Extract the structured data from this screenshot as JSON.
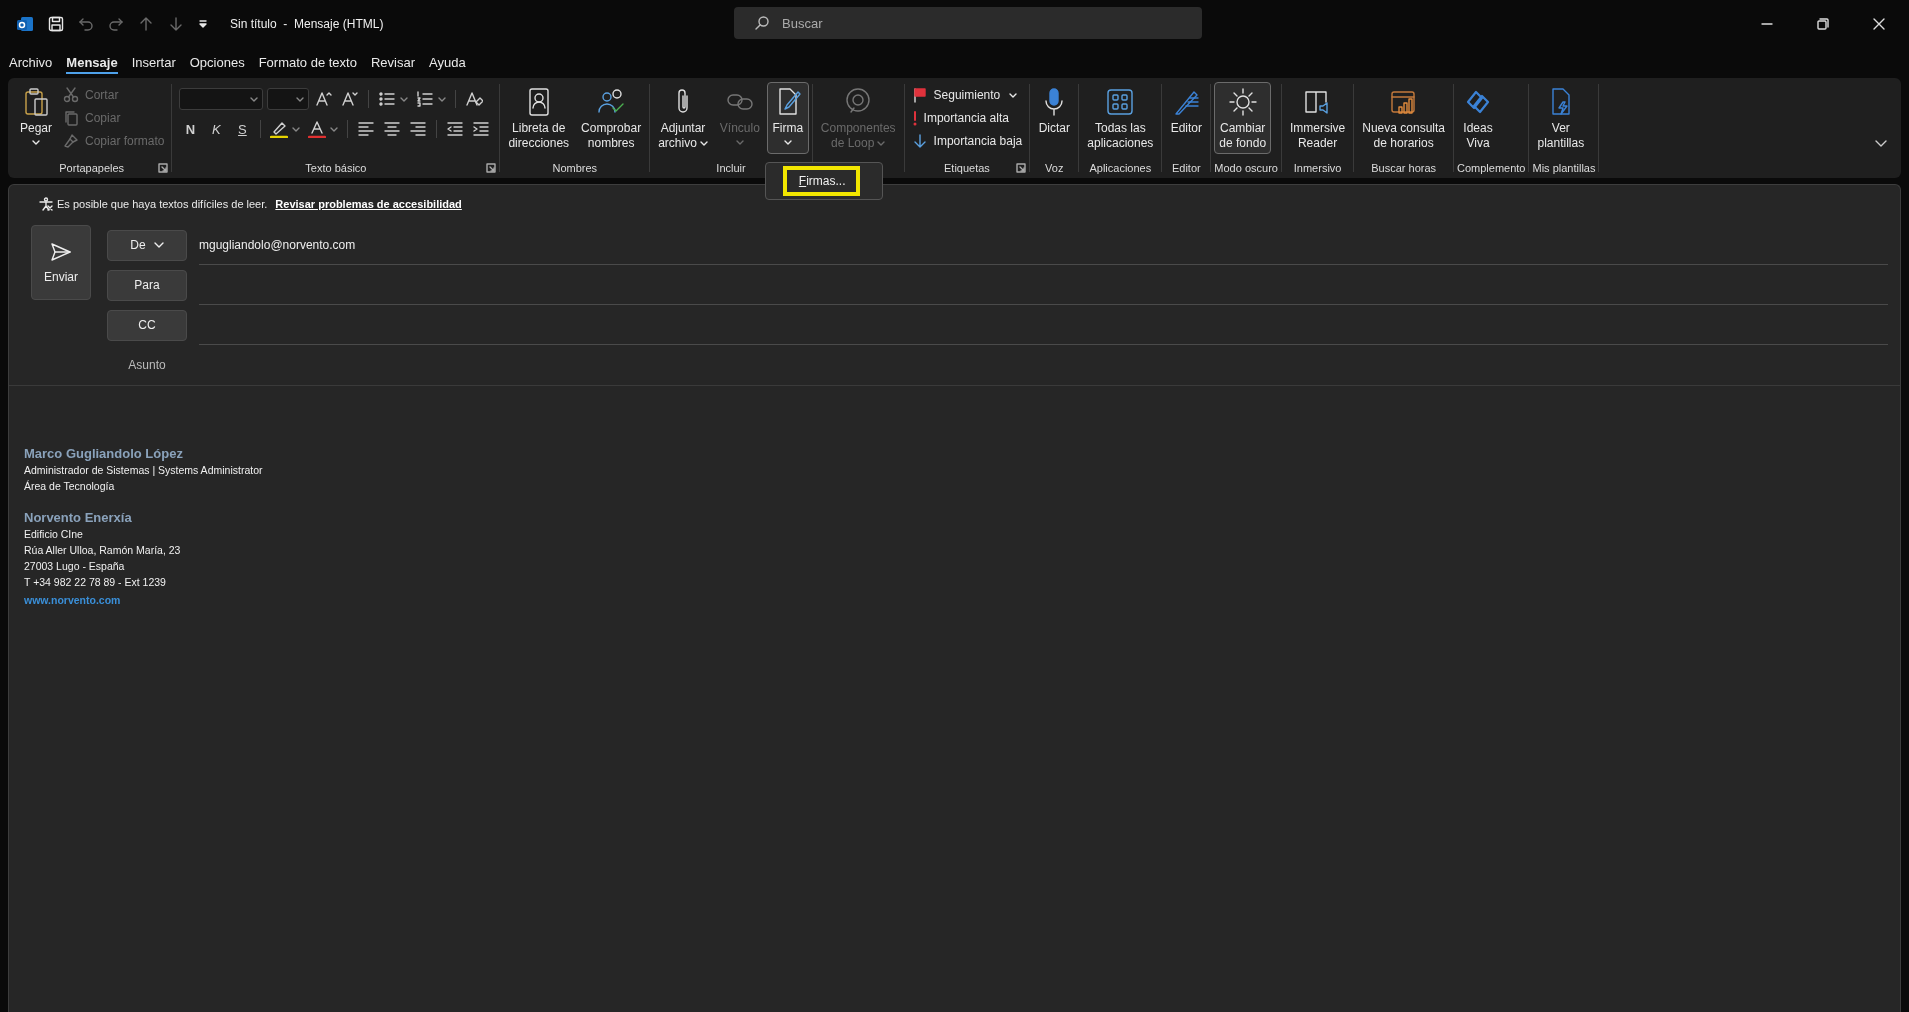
{
  "title_bar": {
    "title": "Sin título  -  Mensaje (HTML)",
    "search": {
      "placeholder": "Buscar"
    }
  },
  "menu_tabs": [
    {
      "label": "Archivo",
      "selected": false
    },
    {
      "label": "Mensaje",
      "selected": true
    },
    {
      "label": "Insertar",
      "selected": false
    },
    {
      "label": "Opciones",
      "selected": false
    },
    {
      "label": "Formato de texto",
      "selected": false
    },
    {
      "label": "Revisar",
      "selected": false
    },
    {
      "label": "Ayuda",
      "selected": false
    }
  ],
  "ribbon": {
    "groups": [
      {
        "label": "Portapapeles",
        "launcher": true,
        "items": [
          {
            "kind": "large",
            "label": [
              "Pegar"
            ],
            "dropdown": true,
            "disabled": false,
            "pressed": false
          },
          {
            "kind": "small",
            "label": "Cortar",
            "disabled": true
          },
          {
            "kind": "small",
            "label": "Copiar",
            "disabled": true
          },
          {
            "kind": "small",
            "label": "Copiar formato",
            "disabled": true
          }
        ]
      },
      {
        "label": "Texto básico",
        "launcher": true,
        "items": [
          {
            "kind": "format",
            "rows": [
              [
                {
                  "kind": "combo"
                },
                {
                  "kind": "combo"
                },
                {
                  "kind": "icon"
                },
                {
                  "kind": "icon"
                },
                {
                  "kind": "separator"
                },
                {
                  "kind": "icon",
                  "dropdown": true
                },
                {
                  "kind": "icon",
                  "dropdown": true
                },
                {
                  "kind": "separator"
                },
                {
                  "kind": "icon"
                }
              ],
              [
                {
                  "kind": "glyph",
                  "text": "N"
                },
                {
                  "kind": "glyph",
                  "text": "K"
                },
                {
                  "kind": "glyph",
                  "text": "S"
                },
                {
                  "kind": "separator"
                },
                {
                  "kind": "icon",
                  "dropdown": true
                },
                {
                  "kind": "icon",
                  "dropdown": true
                },
                {
                  "kind": "separator"
                },
                {
                  "kind": "icon"
                },
                {
                  "kind": "icon"
                },
                {
                  "kind": "icon"
                },
                {
                  "kind": "separator"
                },
                {
                  "kind": "icon"
                },
                {
                  "kind": "icon"
                }
              ]
            ]
          }
        ]
      },
      {
        "label": "Nombres",
        "items": [
          {
            "kind": "large",
            "label": [
              "Libreta de",
              "direcciones"
            ],
            "disabled": false,
            "pressed": false
          },
          {
            "kind": "large",
            "label": [
              "Comprobar",
              "nombres"
            ],
            "disabled": false,
            "pressed": false
          }
        ]
      },
      {
        "label": "Incluir",
        "items": [
          {
            "kind": "large",
            "label": [
              "Adjuntar",
              "archivo"
            ],
            "dropdown": true,
            "disabled": false,
            "pressed": false
          },
          {
            "kind": "large",
            "label": [
              "Vínculo"
            ],
            "dropdown": true,
            "disabled": true,
            "pressed": false
          },
          {
            "kind": "large",
            "label": [
              "Firma"
            ],
            "dropdown": true,
            "disabled": false,
            "pressed": true
          }
        ]
      },
      {
        "items": [
          {
            "kind": "large",
            "label": [
              "Componentes",
              "de Loop"
            ],
            "dropdown": true,
            "disabled": true,
            "pressed": false
          }
        ]
      },
      {
        "label": "Etiquetas",
        "launcher": true,
        "items": [
          {
            "kind": "small",
            "label": "Seguimiento",
            "dropdown": true,
            "disabled": false
          },
          {
            "kind": "small",
            "label": "Importancia alta",
            "disabled": false
          },
          {
            "kind": "small",
            "label": "Importancia baja",
            "disabled": false
          }
        ]
      },
      {
        "label": "Voz",
        "items": [
          {
            "kind": "large",
            "label": [
              "Dictar"
            ],
            "disabled": false,
            "pressed": false
          }
        ]
      },
      {
        "label": "Aplicaciones",
        "items": [
          {
            "kind": "large",
            "label": [
              "Todas las",
              "aplicaciones"
            ],
            "disabled": false,
            "pressed": false
          }
        ]
      },
      {
        "label": "Editor",
        "items": [
          {
            "kind": "large",
            "label": [
              "Editor"
            ],
            "disabled": false,
            "pressed": false
          }
        ]
      },
      {
        "label": "Modo oscuro",
        "items": [
          {
            "kind": "large",
            "label": [
              "Cambiar",
              "de fondo"
            ],
            "disabled": false,
            "pressed": true
          }
        ]
      },
      {
        "label": "Inmersivo",
        "items": [
          {
            "kind": "large",
            "label": [
              "Immersive",
              "Reader"
            ],
            "disabled": false,
            "pressed": false
          }
        ]
      },
      {
        "label": "Buscar horas",
        "items": [
          {
            "kind": "large",
            "label": [
              "Nueva consulta",
              "de horarios"
            ],
            "disabled": false,
            "pressed": false
          }
        ]
      },
      {
        "label": "Complemento",
        "items": [
          {
            "kind": "large",
            "label": [
              "Ideas",
              "Viva"
            ],
            "disabled": false,
            "pressed": false
          }
        ]
      },
      {
        "label": "Mis plantillas",
        "items": [
          {
            "kind": "large",
            "label": [
              "Ver",
              "plantillas"
            ],
            "disabled": false,
            "pressed": false
          }
        ]
      }
    ]
  },
  "signature_menu": {
    "items": [
      {
        "label": "Firmas...",
        "highlighted": true
      }
    ]
  },
  "compose": {
    "notice": {
      "text": "Es posible que haya textos difíciles de leer.",
      "link": "Revisar problemas de accesibilidad"
    },
    "send_button": {
      "label": "Enviar"
    },
    "fields": [
      {
        "kind": "button",
        "label": "De",
        "dropdown": true,
        "value": "mgugliandolo@norvento.com"
      },
      {
        "kind": "button",
        "label": "Para"
      },
      {
        "kind": "button",
        "label": "CC"
      },
      {
        "kind": "label",
        "label": "Asunto"
      }
    ]
  },
  "signature": {
    "blocks": [
      {
        "heading": "Marco Gugliandolo López",
        "lines": [
          "Administrador de Sistemas | Systems Administrator",
          "Área de Tecnología"
        ]
      },
      {
        "heading": "Norvento Enerxía",
        "lines": [
          "Edificio CIne",
          "Rúa Aller Ulloa, Ramón María, 23",
          "27003 Lugo - España",
          "T +34 982 22 78 89 - Ext 1239"
        ],
        "link": "www.norvento.com"
      }
    ]
  }
}
